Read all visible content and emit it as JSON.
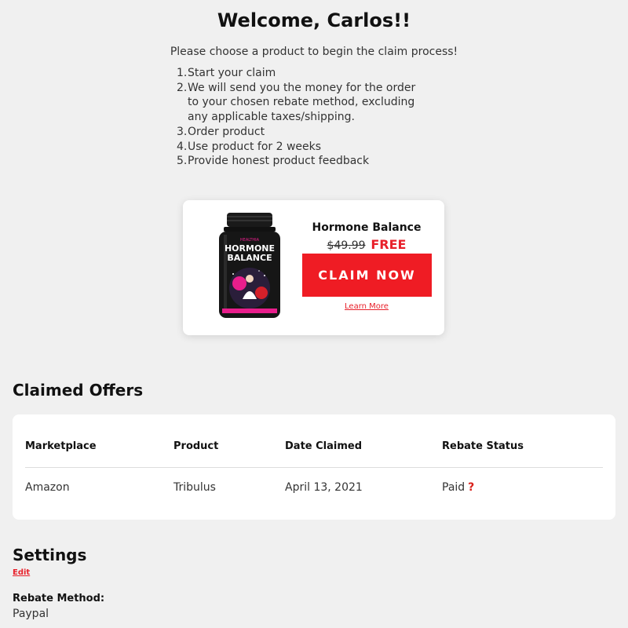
{
  "header": {
    "welcome": "Welcome, Carlos!!",
    "intro": "Please choose a product to begin the claim process!"
  },
  "steps": [
    {
      "num": "1.",
      "text": "Start your claim"
    },
    {
      "num": "2.",
      "text": "We will send you the money for the order to your chosen rebate method, excluding any applicable taxes/shipping."
    },
    {
      "num": "3.",
      "text": "Order product"
    },
    {
      "num": "4.",
      "text": "Use product for 2 weeks"
    },
    {
      "num": "5.",
      "text": "Provide honest product feedback"
    }
  ],
  "product": {
    "name": "Hormone Balance",
    "old_price": "$49.99",
    "price": "FREE",
    "claim_label": "CLAIM NOW",
    "learn_more": "Learn More",
    "bottle_brand": "HEALTHIA",
    "bottle_text_line1": "HORMONE",
    "bottle_text_line2": "BALANCE"
  },
  "claimed": {
    "title": "Claimed Offers",
    "headers": [
      "Marketplace",
      "Product",
      "Date Claimed",
      "Rebate Status"
    ],
    "rows": [
      [
        "Amazon",
        "Tribulus",
        "April 13, 2021",
        "Paid"
      ]
    ],
    "status_icon": "question-mark-icon"
  },
  "settings": {
    "title": "Settings",
    "edit_label": "Edit",
    "rebate_method_label": "Rebate Method:",
    "rebate_method_value": "Paypal"
  },
  "colors": {
    "accent": "#ef1c24",
    "background": "#f0f0f0"
  }
}
